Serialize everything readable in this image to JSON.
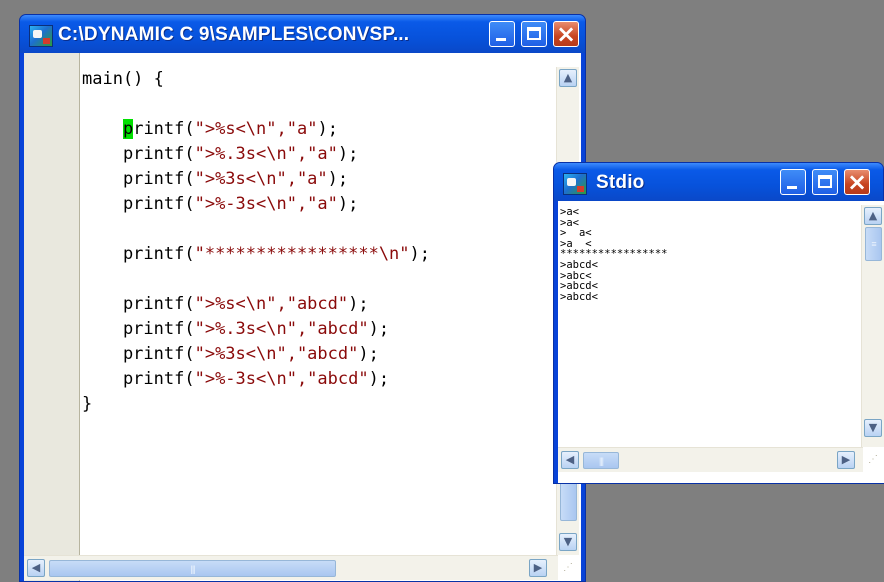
{
  "editor": {
    "title": "C:\\DYNAMIC C 9\\SAMPLES\\CONVSP...",
    "code_lines": [
      {
        "pre": "main() {",
        "str": "",
        "post": ""
      },
      {
        "pre": "",
        "str": "",
        "post": ""
      },
      {
        "pre": "    printf(",
        "str": "\">%s<\\n\",\"a\"",
        "post": ");"
      },
      {
        "pre": "    printf(",
        "str": "\">%.3s<\\n\",\"a\"",
        "post": ");"
      },
      {
        "pre": "    printf(",
        "str": "\">%3s<\\n\",\"a\"",
        "post": ");"
      },
      {
        "pre": "    printf(",
        "str": "\">%-3s<\\n\",\"a\"",
        "post": ");"
      },
      {
        "pre": "",
        "str": "",
        "post": ""
      },
      {
        "pre": "    printf(",
        "str": "\"*****************\\n\"",
        "post": ");"
      },
      {
        "pre": "",
        "str": "",
        "post": ""
      },
      {
        "pre": "    printf(",
        "str": "\">%s<\\n\",\"abcd\"",
        "post": ");"
      },
      {
        "pre": "    printf(",
        "str": "\">%.3s<\\n\",\"abcd\"",
        "post": ");"
      },
      {
        "pre": "    printf(",
        "str": "\">%3s<\\n\",\"abcd\"",
        "post": ");"
      },
      {
        "pre": "    printf(",
        "str": "\">%-3s<\\n\",\"abcd\"",
        "post": ");"
      },
      {
        "pre": "}",
        "str": "",
        "post": ""
      }
    ],
    "scroll_h": {
      "position": 0.0
    }
  },
  "stdio": {
    "title": "Stdio",
    "output_lines": [
      ">a<",
      ">a<",
      ">  a<",
      ">a  <",
      "*****************",
      ">abcd<",
      ">abc<",
      ">abcd<",
      ">abcd<"
    ]
  },
  "colors": {
    "titlebar": "#0752db",
    "code_string": "#8a0a0a",
    "caret": "#00e000",
    "desktop": "#7f7f7f"
  },
  "icons": {
    "app": "dynamic-c-app-icon",
    "minimize": "minimize-icon",
    "maximize": "maximize-icon",
    "close": "close-icon"
  }
}
